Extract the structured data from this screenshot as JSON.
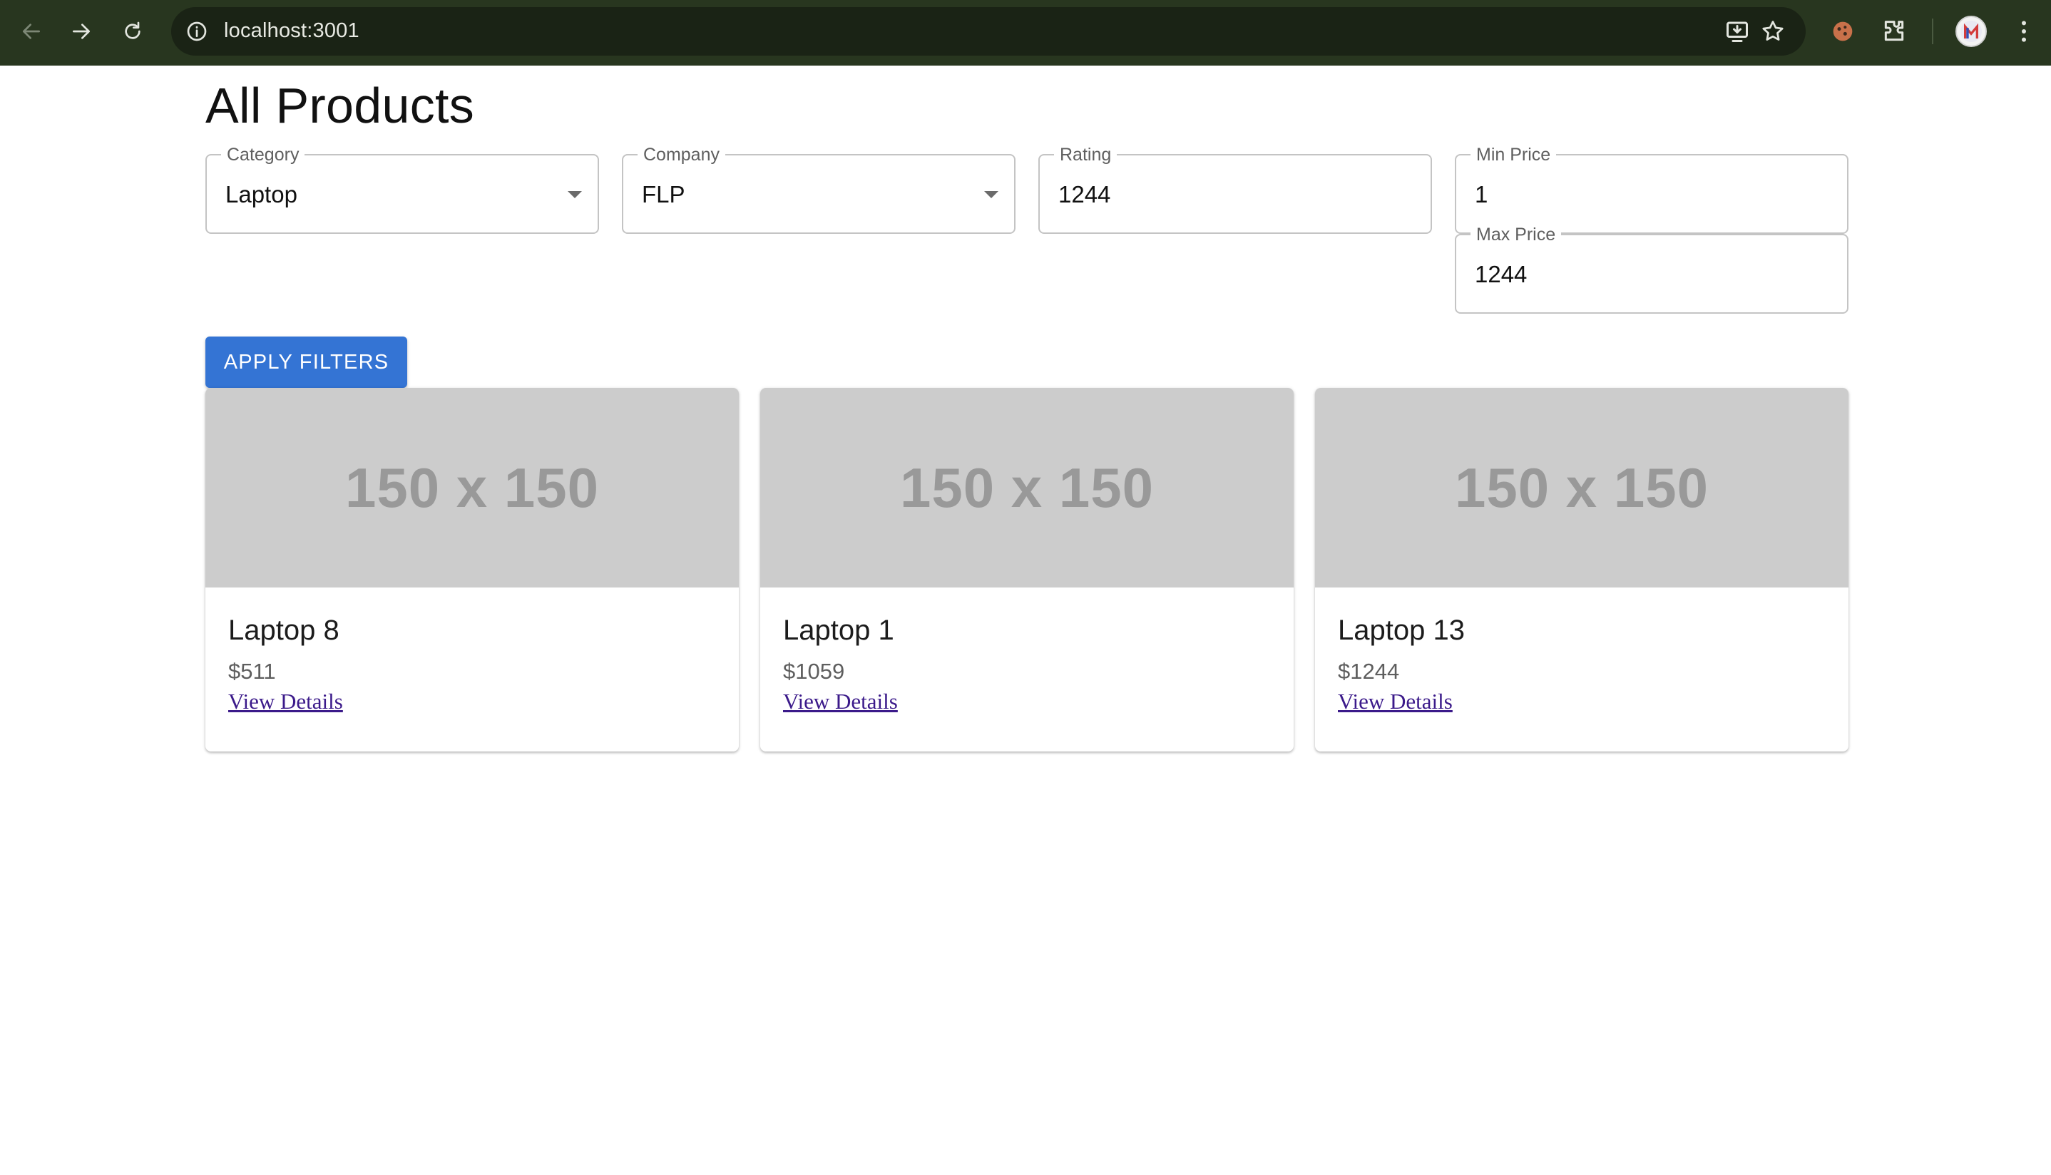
{
  "browser": {
    "url": "localhost:3001"
  },
  "page": {
    "title": "All Products"
  },
  "filters": {
    "category": {
      "label": "Category",
      "value": "Laptop"
    },
    "company": {
      "label": "Company",
      "value": "FLP"
    },
    "rating": {
      "label": "Rating",
      "value": "1244"
    },
    "min_price": {
      "label": "Min Price",
      "value": "1"
    },
    "max_price": {
      "label": "Max Price",
      "value": "1244"
    },
    "apply_label": "APPLY FILTERS"
  },
  "products": [
    {
      "image_text": "150 x 150",
      "name": "Laptop 8",
      "price": "$511",
      "link": "View Details"
    },
    {
      "image_text": "150 x 150",
      "name": "Laptop 1",
      "price": "$1059",
      "link": "View Details"
    },
    {
      "image_text": "150 x 150",
      "name": "Laptop 13",
      "price": "$1244",
      "link": "View Details"
    }
  ]
}
